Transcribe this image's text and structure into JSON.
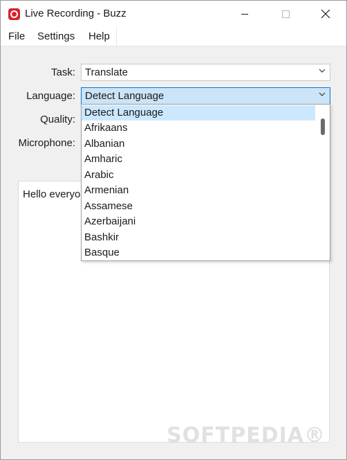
{
  "window": {
    "title": "Live Recording - Buzz",
    "app_icon": "buzz-record-icon",
    "controls": {
      "minimize": "minimize-icon",
      "maximize": "maximize-icon",
      "close": "close-icon"
    }
  },
  "menubar": {
    "items": [
      {
        "label": "File"
      },
      {
        "label": "Settings"
      },
      {
        "label": "Help"
      }
    ]
  },
  "form": {
    "task": {
      "label": "Task:",
      "value": "Translate"
    },
    "language": {
      "label": "Language:",
      "value": "Detect Language"
    },
    "quality": {
      "label": "Quality:"
    },
    "microphone": {
      "label": "Microphone:"
    }
  },
  "language_dropdown": {
    "selected": "Detect Language",
    "options": [
      "Detect Language",
      "Afrikaans",
      "Albanian",
      "Amharic",
      "Arabic",
      "Armenian",
      "Assamese",
      "Azerbaijani",
      "Bashkir",
      "Basque"
    ]
  },
  "transcript": {
    "text": "Hello everyone"
  },
  "watermark": "SOFTPEDIA®",
  "colors": {
    "accent": "#0078d7",
    "selection": "#cce8ff",
    "app_icon": "#d9232e"
  }
}
